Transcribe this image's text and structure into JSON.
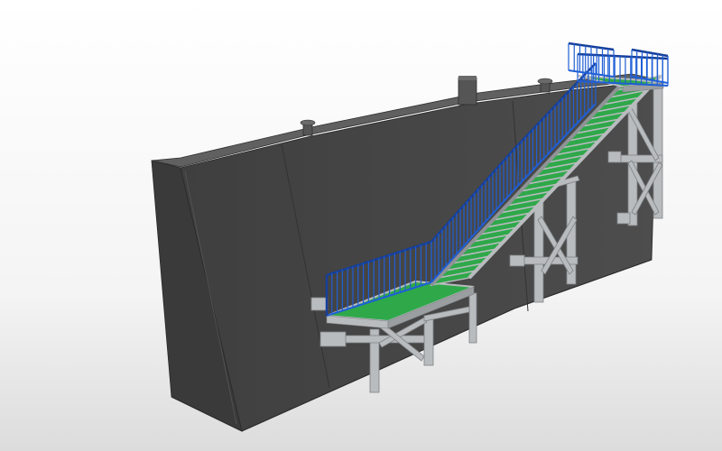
{
  "colors": {
    "background_top": "#ffffff",
    "background_bottom": "#dcdcdc",
    "wall_front": "#4a4a4a",
    "wall_top": "#5c5c5c",
    "wall_edge": "#2e2e2e",
    "steel": "#b9bcbf",
    "steel_dark": "#8f9396",
    "grating": "#2fa84a",
    "railing": "#1f5fd6",
    "railing_dark": "#163f99"
  },
  "icons": [
    "bollard-icon",
    "vent-icon"
  ]
}
